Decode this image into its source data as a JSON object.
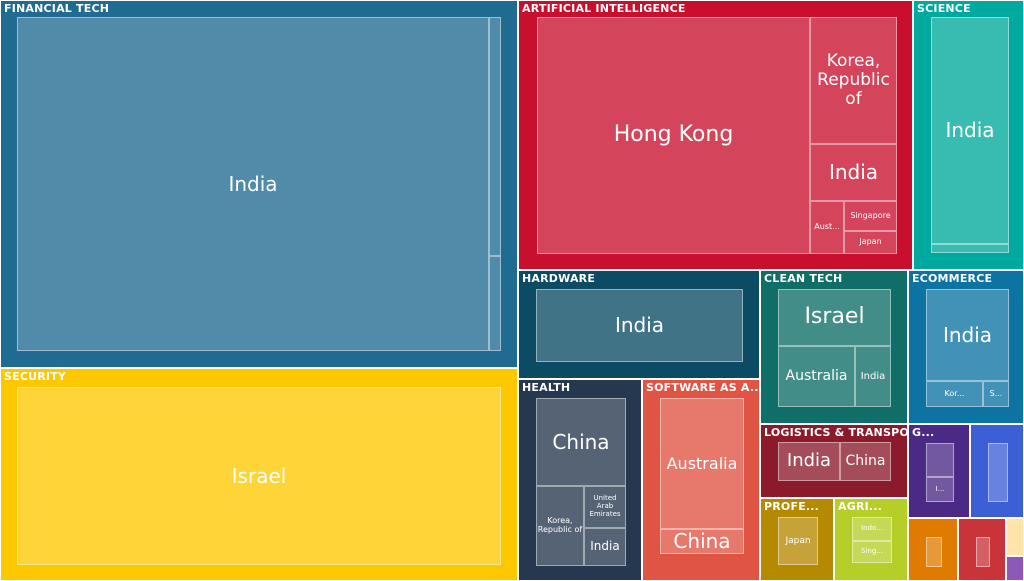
{
  "chart_data": {
    "type": "treemap",
    "title": "",
    "sectors": [
      {
        "name": "FINANCIAL TECH",
        "color": "#1f6b91",
        "children": [
          {
            "label": "India",
            "value": 96.3
          },
          {
            "label": "",
            "value": 2.4
          },
          {
            "label": "",
            "value": 1.3
          }
        ]
      },
      {
        "name": "SECURITY",
        "color": "#fec800",
        "children": [
          {
            "label": "Israel",
            "value": 100
          }
        ]
      },
      {
        "name": "ARTIFICIAL INTELLIGENCE",
        "color": "#c8102e",
        "children": [
          {
            "label": "Hong Kong",
            "value": 58
          },
          {
            "label": "Korea, Republic of",
            "value": 17
          },
          {
            "label": "India",
            "value": 15
          },
          {
            "label": "Aust...",
            "value": 4
          },
          {
            "label": "Singapore",
            "value": 3.5
          },
          {
            "label": "Japan",
            "value": 2.5
          }
        ]
      },
      {
        "name": "SCIENCE",
        "color": "#00a99d",
        "children": [
          {
            "label": "India",
            "value": 96
          },
          {
            "label": "",
            "value": 4
          }
        ]
      },
      {
        "name": "HARDWARE",
        "color": "#0b4c64",
        "children": [
          {
            "label": "India",
            "value": 100
          }
        ]
      },
      {
        "name": "CLEAN TECH",
        "color": "#0f6e67",
        "children": [
          {
            "label": "Israel",
            "value": 44
          },
          {
            "label": "Australia",
            "value": 36
          },
          {
            "label": "India",
            "value": 20
          }
        ]
      },
      {
        "name": "ECOMMERCE",
        "color": "#0d73a3",
        "children": [
          {
            "label": "India",
            "value": 78
          },
          {
            "label": "Kor...",
            "value": 14
          },
          {
            "label": "S...",
            "value": 8
          }
        ]
      },
      {
        "name": "HEALTH",
        "color": "#26384f",
        "children": [
          {
            "label": "China",
            "value": 52
          },
          {
            "label": "Korea, Republic of",
            "value": 25
          },
          {
            "label": "United Arab Emirates",
            "value": 14
          },
          {
            "label": "India",
            "value": 9
          }
        ]
      },
      {
        "name": "SOFTWARE AS A...",
        "color": "#e05443",
        "children": [
          {
            "label": "Australia",
            "value": 78
          },
          {
            "label": "China",
            "value": 22
          }
        ]
      },
      {
        "name": "LOGISTICS & TRANSPOR...",
        "color": "#8b1a2b",
        "children": [
          {
            "label": "India",
            "value": 55
          },
          {
            "label": "China",
            "value": 45
          }
        ]
      },
      {
        "name": "PROFE...",
        "color": "#b58a00",
        "children": [
          {
            "label": "Japan",
            "value": 100
          }
        ]
      },
      {
        "name": "AGRI...",
        "color": "#b5cf28",
        "children": [
          {
            "label": "Indo...",
            "value": 50
          },
          {
            "label": "Sing...",
            "value": 50
          }
        ]
      },
      {
        "name": "G...",
        "color": "#4b2a85",
        "children": [
          {
            "label": "",
            "value": 60
          },
          {
            "label": "I...",
            "value": 40
          }
        ]
      },
      {
        "name": "",
        "color": "#3d5fd6",
        "children": [
          {
            "label": "",
            "value": 100
          }
        ]
      },
      {
        "name": "",
        "color": "#e07b00",
        "children": [
          {
            "label": "",
            "value": 100
          }
        ]
      },
      {
        "name": "",
        "color": "#c8343a",
        "children": [
          {
            "label": "",
            "value": 100
          }
        ]
      },
      {
        "name": "",
        "color": "#ffe3a8",
        "children": [
          {
            "label": "",
            "value": 100
          }
        ]
      },
      {
        "name": "",
        "color": "#8e58b8",
        "children": [
          {
            "label": "",
            "value": 100
          }
        ]
      }
    ]
  }
}
